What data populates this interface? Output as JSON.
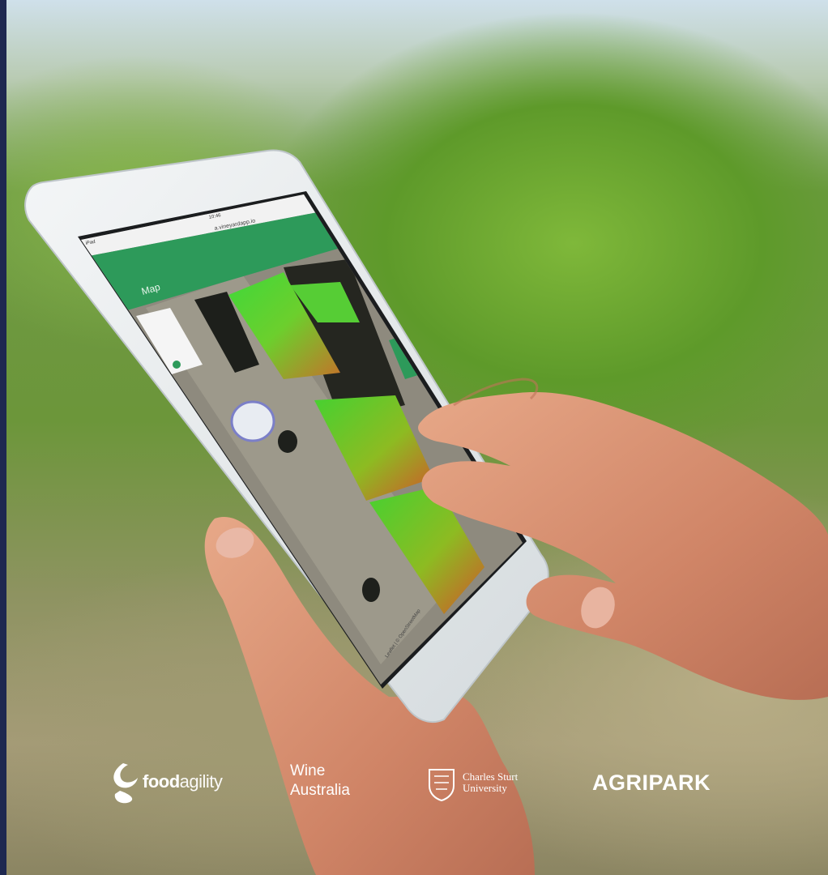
{
  "tablet_screen": {
    "browser_url_text": "a.vineyardapp.io",
    "status_time": "10:46",
    "status_left": "iPad",
    "app_title": "Map",
    "map_scale_text": "Leaflet | © OpenStreetMap"
  },
  "logos": [
    {
      "name": "foodagility",
      "part1": "food",
      "part2": "agility"
    },
    {
      "name": "wine-australia",
      "line1": "Wine",
      "line2": "Australia"
    },
    {
      "name": "charles-sturt-university",
      "line1": "Charles Sturt",
      "line2": "University"
    },
    {
      "name": "agripark",
      "text": "AGRIPARK"
    }
  ],
  "colors": {
    "edge_bar": "#1e2850",
    "app_header": "#2d9a5a",
    "ndvi_green": "#34d33a",
    "vine_foliage": "#6c963a"
  },
  "icons": [
    "back-icon",
    "forward-icon",
    "bookmarks-icon",
    "share-icon",
    "tabs-icon",
    "menu-icon",
    "layers-icon",
    "zoom-icon",
    "shield-logo-icon",
    "swoosh-logo-icon"
  ]
}
